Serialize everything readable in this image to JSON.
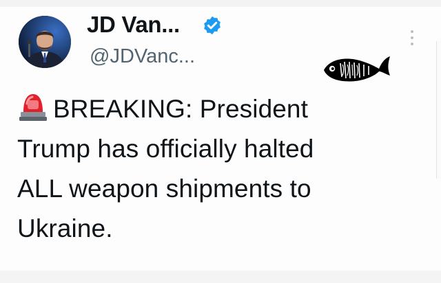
{
  "author": {
    "display_name": "JD Van...",
    "handle": "@JDVanc...",
    "verified": true
  },
  "tweet": {
    "emoji": "siren-icon",
    "line1": "BREAKING: President",
    "line2": "Trump has officially halted",
    "line3": "ALL weapon shipments to",
    "line4": "Ukraine."
  },
  "icons": {
    "verified": "verified-badge-icon",
    "more": "more-options-icon",
    "sticker": "fish-sticker-icon"
  },
  "colors": {
    "verified_blue": "#1d9bf0",
    "text": "#0f1419",
    "handle_gray": "#536471",
    "siren_red": "#e0202a"
  }
}
